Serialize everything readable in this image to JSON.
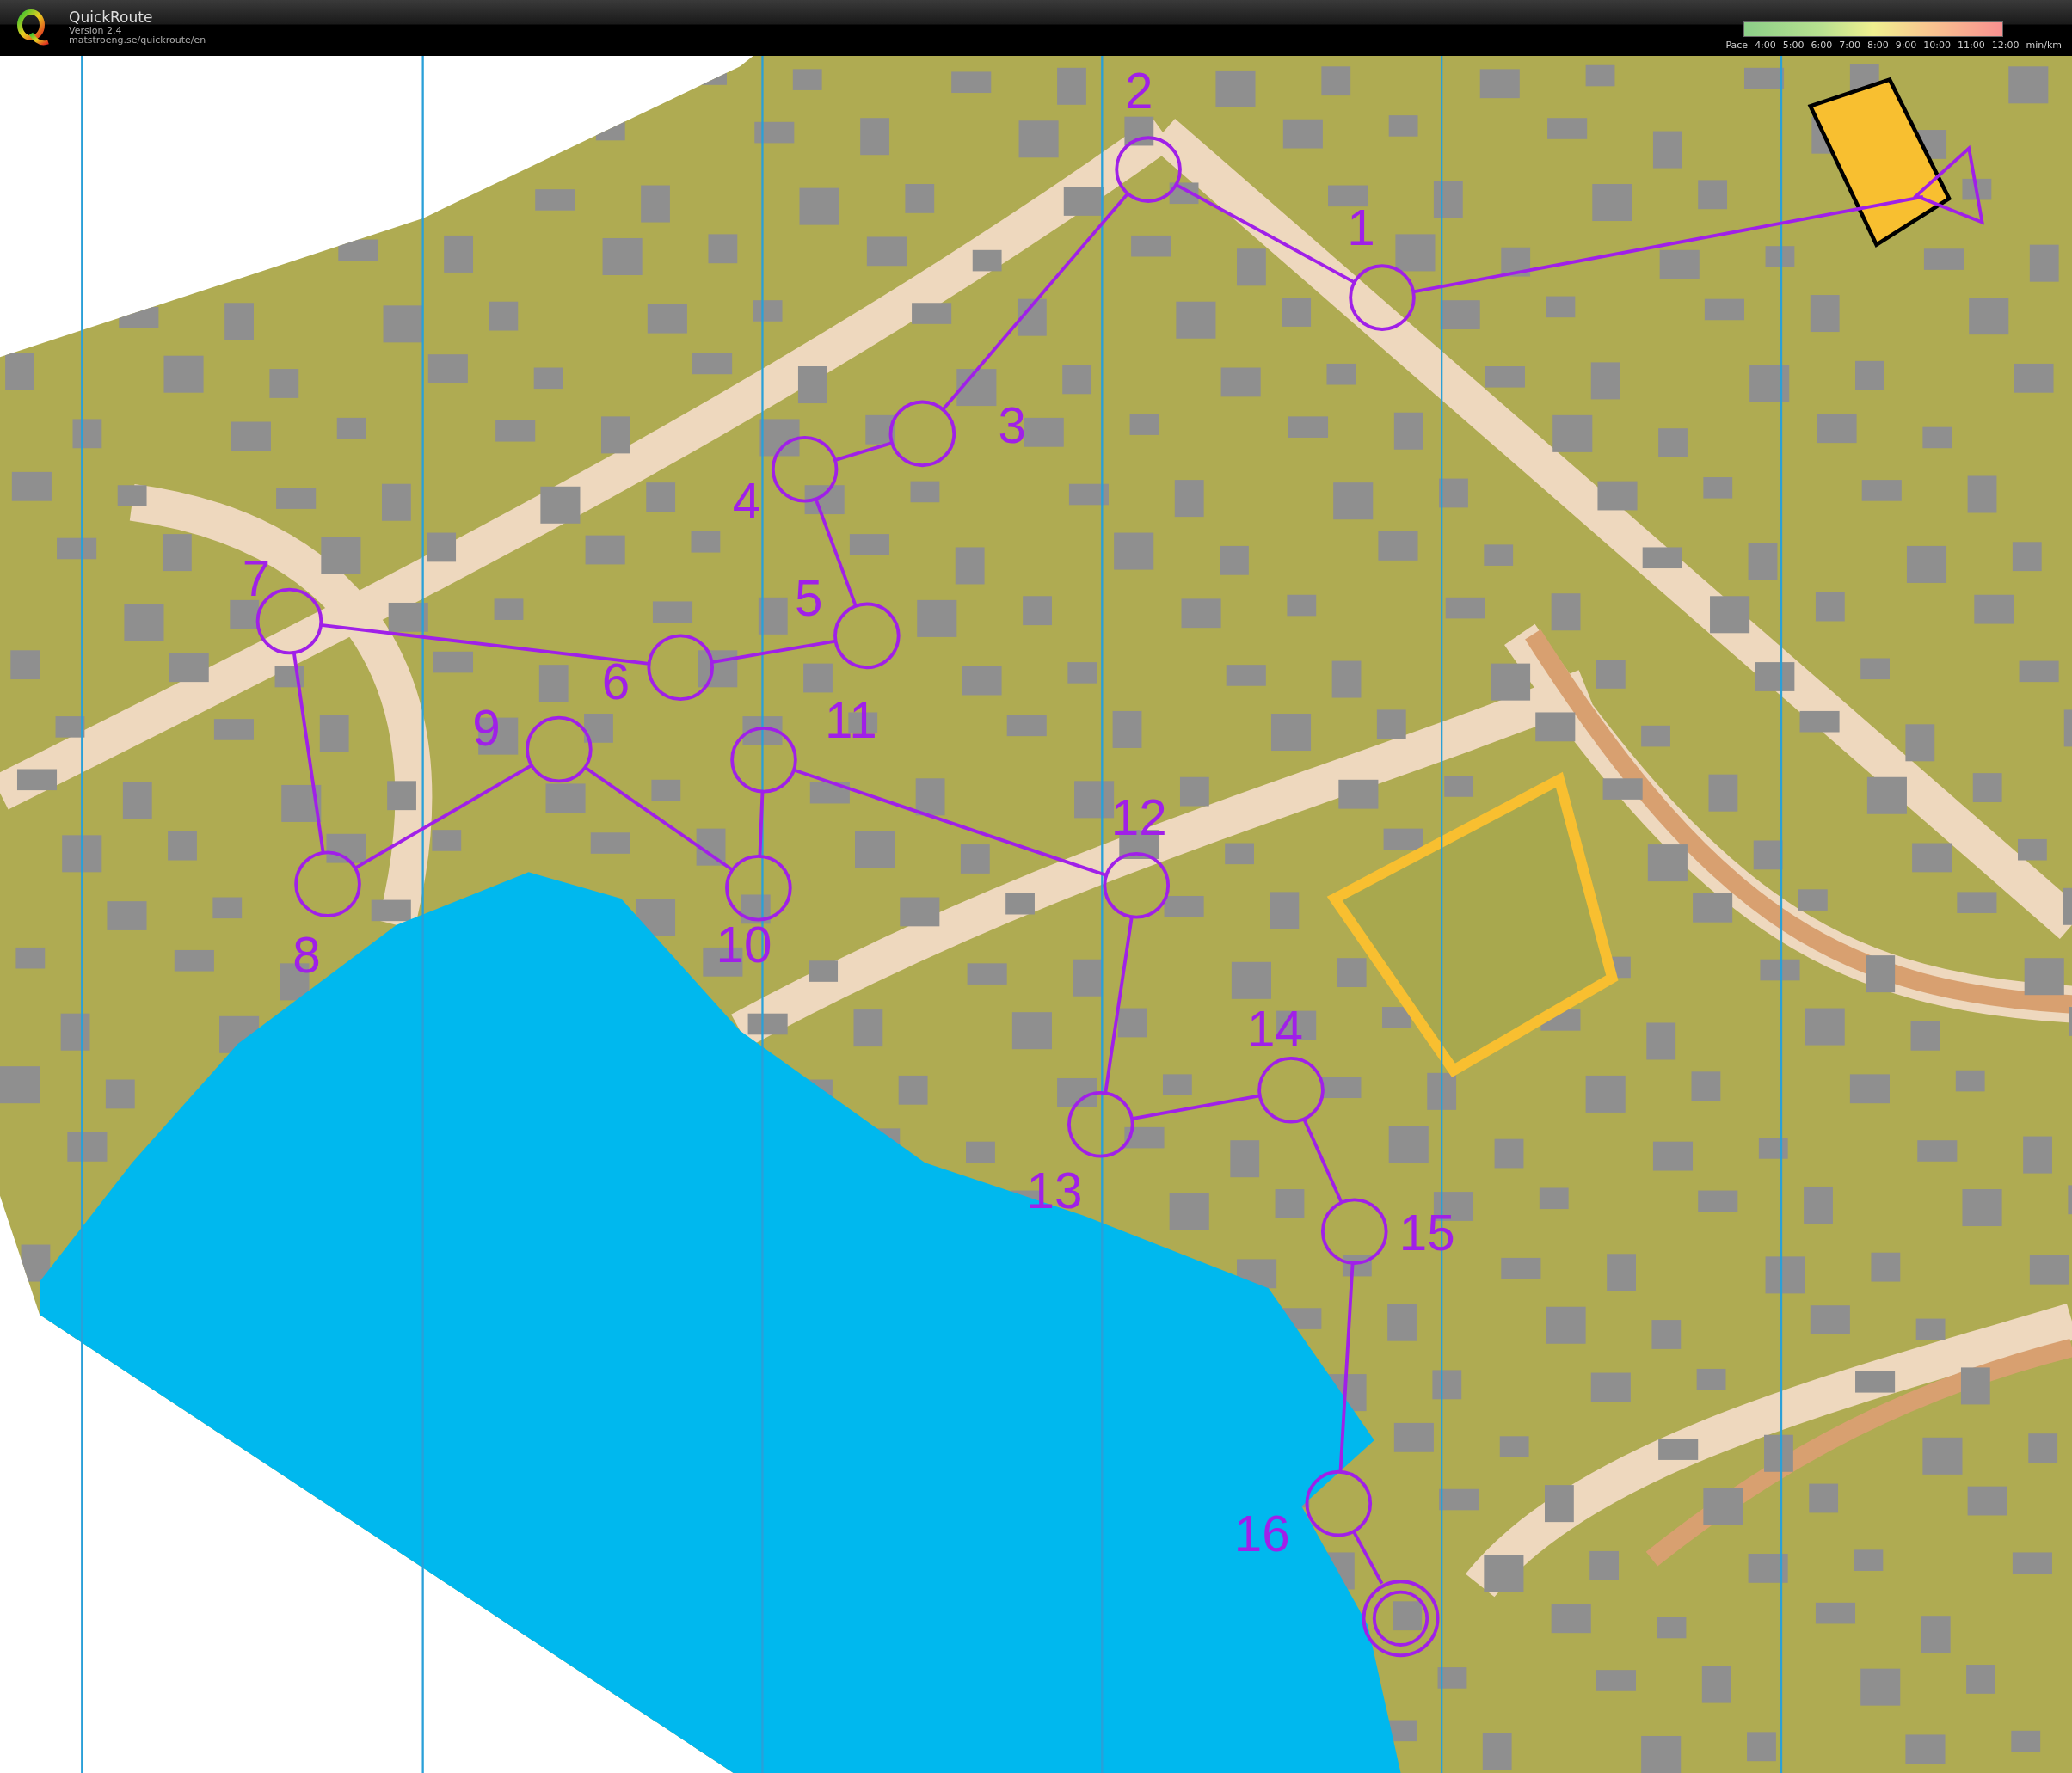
{
  "header": {
    "app_name": "QuickRoute",
    "version": "Version 2.4",
    "url": "matstroeng.se/quickroute/en"
  },
  "pace_legend": {
    "label": "Pace",
    "ticks": [
      "4:00",
      "5:00",
      "6:00",
      "7:00",
      "8:00",
      "9:00",
      "10:00",
      "11:00",
      "12:00"
    ],
    "unit": "min/km"
  },
  "course": {
    "controls": [
      "1",
      "2",
      "3",
      "4",
      "5",
      "6",
      "7",
      "8",
      "9",
      "10",
      "11",
      "12",
      "13",
      "14",
      "15",
      "16"
    ]
  }
}
